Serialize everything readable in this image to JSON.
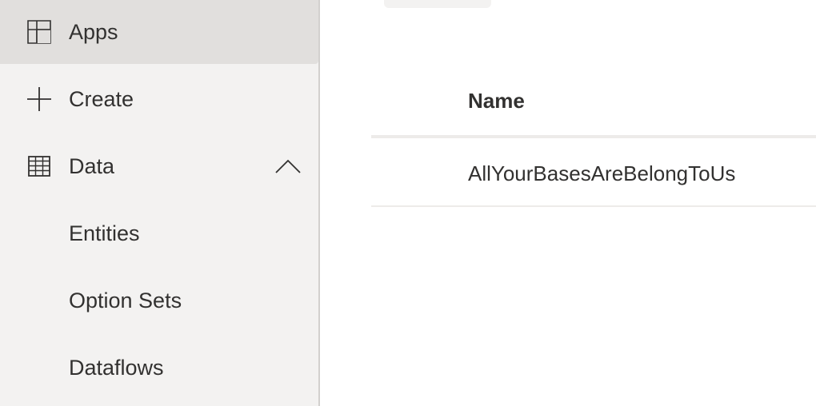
{
  "sidebar": {
    "items": [
      {
        "label": "Apps",
        "icon": "apps-icon",
        "selected": true
      },
      {
        "label": "Create",
        "icon": "plus-icon"
      },
      {
        "label": "Data",
        "icon": "table-icon",
        "expanded": true
      },
      {
        "label": "Entities"
      },
      {
        "label": "Option Sets"
      },
      {
        "label": "Dataflows"
      }
    ]
  },
  "table": {
    "columns": [
      "Name"
    ],
    "rows": [
      {
        "name": "AllYourBasesAreBelongToUs"
      }
    ]
  },
  "colors": {
    "sidebar_bg": "#f3f2f1",
    "selected_bg": "#e1dfdd",
    "text": "#323130",
    "divider": "#edebe9"
  }
}
